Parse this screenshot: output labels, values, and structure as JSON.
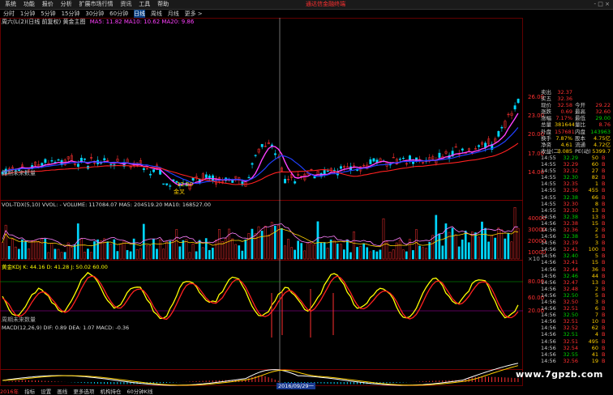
{
  "menu": {
    "items": [
      "系统",
      "功能",
      "报价",
      "分析",
      "扩展市场行情",
      "资讯",
      "工具",
      "帮助"
    ],
    "ad_text": "通达信金融终端",
    "window_buttons": "- □ ×"
  },
  "periods": {
    "items": [
      "分时",
      "1分钟",
      "5分钟",
      "15分钟",
      "30分钟",
      "60分钟",
      "日线",
      "周线",
      "月线",
      "更多 >"
    ],
    "active_index": 6
  },
  "main_panel": {
    "title": "周六(L(2)(日线 前复权) 黄金主图",
    "ma_text": "MA5: 11.82  MA10: 10.62  MA20: 9.86",
    "sub_label": "周期未来数量",
    "price_marks": [
      "12.00",
      "金叉"
    ],
    "y_ticks": [
      "26.00",
      "23.00",
      "20.00",
      "17.00",
      "14.00"
    ]
  },
  "vol_panel": {
    "title": "VOL-TDX(5,10)  VVOL: -  VOLUME: 117084.07  MA5: 204519.20  MA10: 168527.00",
    "y_ticks": [
      "40000",
      "30000",
      "20000",
      "10000"
    ],
    "unit": "×10"
  },
  "kdj_panel": {
    "title": "黄金KDJ  K: 44.16  D: 41.28  J: 50.02  60.00",
    "y_ticks": [
      "80.00",
      "60.00",
      "20.00"
    ],
    "sub_label": "周期未来数量"
  },
  "macd_panel": {
    "title": "MACD(12,26,9)  DIF: 0.89  DEA: 1.07  MACD: -0.36",
    "x_date": "2016/09/29一"
  },
  "right_panel": {
    "quote_rows": [
      {
        "k": "卖出",
        "v": "32.37",
        "k2": "",
        "v2": "",
        "vc": "#ff3030"
      },
      {
        "k": "买五",
        "v": "32.36",
        "k2": "",
        "v2": "",
        "vc": "#ff3030"
      },
      {
        "k": "现价",
        "v": "32.58",
        "k2": "今开",
        "v2": "29.22",
        "vc": "#ff3030",
        "v2c": "#ff3030"
      },
      {
        "k": "涨跌",
        "v": "0.69",
        "k2": "最高",
        "v2": "32.60",
        "vc": "#ff3030",
        "v2c": "#ff3030"
      },
      {
        "k": "涨幅",
        "v": "7.17%",
        "k2": "最低",
        "v2": "29.00",
        "vc": "#ff3030",
        "v2c": "#00d000"
      },
      {
        "k": "总量",
        "v": "381644",
        "k2": "量比",
        "v2": "8.76",
        "vc": "#ffd000",
        "v2c": "#ff3030"
      },
      {
        "k": "外盘",
        "v": "157681",
        "k2": "内盘",
        "v2": "143963",
        "vc": "#ff3030",
        "v2c": "#00d000"
      },
      {
        "k": "换手",
        "v": "7.87%",
        "k2": "股本",
        "v2": "4.75亿",
        "vc": "#ffd000",
        "v2c": "#ffd000"
      },
      {
        "k": "净资",
        "v": "4.61",
        "k2": "流通",
        "v2": "4.72亿",
        "vc": "#ffd000",
        "v2c": "#ffd000"
      },
      {
        "k": "收益(二)",
        "v": "0.085",
        "k2": "PE(动)",
        "v2": "5399.7",
        "vc": "#ffd000",
        "v2c": "#ffd000"
      }
    ],
    "ticks": [
      {
        "t": "14:55",
        "p": "32.29",
        "q": "50",
        "b": "B"
      },
      {
        "t": "14:55",
        "p": "32.29",
        "q": "60",
        "b": "B"
      },
      {
        "t": "14:55",
        "p": "32.32",
        "q": "27",
        "b": "B"
      },
      {
        "t": "14:55",
        "p": "32.30",
        "q": "82",
        "b": "B"
      },
      {
        "t": "14:55",
        "p": "32.35",
        "q": "1",
        "b": "B"
      },
      {
        "t": "14:55",
        "p": "32.36",
        "q": "455",
        "b": "B"
      },
      {
        "t": "14:55",
        "p": "32.38",
        "q": "66",
        "b": "B"
      },
      {
        "t": "14:55",
        "p": "32.30",
        "q": "8",
        "b": "B"
      },
      {
        "t": "14:55",
        "p": "32.30",
        "q": "13",
        "b": "B"
      },
      {
        "t": "14:56",
        "p": "32.38",
        "q": "13",
        "b": "B"
      },
      {
        "t": "14:56",
        "p": "32.38",
        "q": "15",
        "b": "B"
      },
      {
        "t": "14:56",
        "p": "32.36",
        "q": "2",
        "b": "B"
      },
      {
        "t": "14:56",
        "p": "32.38",
        "q": "5",
        "b": "B"
      },
      {
        "t": "14:56",
        "p": "32.39",
        "q": "3",
        "b": "B"
      },
      {
        "t": "14:56",
        "p": "32.41",
        "q": "100",
        "b": "B"
      },
      {
        "t": "14:56",
        "p": "32.40",
        "q": "5",
        "b": "B"
      },
      {
        "t": "14:56",
        "p": "32.41",
        "q": "15",
        "b": "B"
      },
      {
        "t": "14:56",
        "p": "32.44",
        "q": "36",
        "b": "B"
      },
      {
        "t": "14:56",
        "p": "32.46",
        "q": "44",
        "b": "B"
      },
      {
        "t": "14:56",
        "p": "32.47",
        "q": "13",
        "b": "B"
      },
      {
        "t": "14:56",
        "p": "32.48",
        "q": "2",
        "b": "B"
      },
      {
        "t": "14:56",
        "p": "32.50",
        "q": "5",
        "b": "B"
      },
      {
        "t": "14:56",
        "p": "32.50",
        "q": "3",
        "b": "B"
      },
      {
        "t": "14:56",
        "p": "32.51",
        "q": "6",
        "b": "B"
      },
      {
        "t": "14:56",
        "p": "32.50",
        "q": "7",
        "b": "B"
      },
      {
        "t": "14:56",
        "p": "32.51",
        "q": "10",
        "b": "B"
      },
      {
        "t": "14:56",
        "p": "32.52",
        "q": "62",
        "b": "B"
      },
      {
        "t": "14:56",
        "p": "32.51",
        "q": "4",
        "b": "B"
      },
      {
        "t": "14:56",
        "p": "32.51",
        "q": "495",
        "b": "B"
      },
      {
        "t": "14:56",
        "p": "32.54",
        "q": "60",
        "b": "B"
      },
      {
        "t": "14:56",
        "p": "32.55",
        "q": "41",
        "b": "B"
      },
      {
        "t": "14:56",
        "p": "32.56",
        "q": "19",
        "b": "B"
      }
    ]
  },
  "bottom": {
    "items": [
      "2016年",
      "指标",
      "设置",
      "画线",
      "更多选项",
      "机构持仓",
      "60分钟K线"
    ]
  },
  "watermark": "www.7gpzb.com",
  "colors": {
    "up": "#ff3030",
    "down": "#00d8ff",
    "ma5": "#ff40ff",
    "ma10": "#2040ff",
    "ma20": "#ff2020",
    "k": "#ffff00",
    "d": "#ff2020",
    "grid": "#7a0000"
  }
}
